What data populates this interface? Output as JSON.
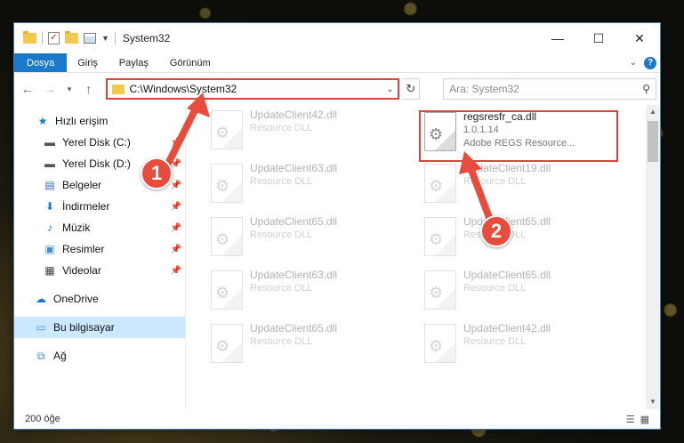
{
  "window": {
    "title": "System32",
    "controls": {
      "minimize": "—",
      "maximize": "☐",
      "close": "✕"
    }
  },
  "ribbon": {
    "tabs": [
      "Dosya",
      "Giriş",
      "Paylaş",
      "Görünüm"
    ]
  },
  "address": {
    "path": "C:\\Windows\\System32",
    "search_placeholder": "Ara: System32"
  },
  "sidebar": {
    "quick_access": "Hızlı erişim",
    "items": [
      {
        "label": "Yerel Disk (C:)",
        "icon": "drive-icon",
        "pinned": true
      },
      {
        "label": "Yerel Disk (D:)",
        "icon": "drive-icon",
        "pinned": true
      },
      {
        "label": "Belgeler",
        "icon": "documents-icon",
        "pinned": true
      },
      {
        "label": "İndirmeler",
        "icon": "download-icon",
        "pinned": true
      },
      {
        "label": "Müzik",
        "icon": "music-icon",
        "pinned": true
      },
      {
        "label": "Resimler",
        "icon": "pictures-icon",
        "pinned": true
      },
      {
        "label": "Videolar",
        "icon": "videos-icon",
        "pinned": true
      }
    ],
    "onedrive": "OneDrive",
    "this_pc": "Bu bilgisayar",
    "network": "Ağ"
  },
  "files": {
    "left_column": [
      {
        "name": "UpdateClient42.dll",
        "type": "Resource DLL"
      },
      {
        "name": "UpdateClient63.dll",
        "type": "Resource DLL"
      },
      {
        "name": "UpdateClient65.dll",
        "type": "Resource DLL"
      },
      {
        "name": "UpdateClient63.dll",
        "type": "Resource DLL"
      },
      {
        "name": "UpdateClient65.dll",
        "type": "Resource DLL"
      }
    ],
    "right_column": [
      {
        "name": "regsresfr_ca.dll",
        "version": "1.0.1.14",
        "type": "Adobe REGS Resource..."
      },
      {
        "name": "UpdateClient19.dll",
        "type": "Resource DLL"
      },
      {
        "name": "UpdateClient65.dll",
        "type": "Resource DLL"
      },
      {
        "name": "UpdateClient65.dll",
        "type": "Resource DLL"
      },
      {
        "name": "UpdateClient42.dll",
        "type": "Resource DLL"
      }
    ]
  },
  "status": {
    "count": "200 öğe"
  },
  "callouts": [
    "1",
    "2"
  ],
  "colors": {
    "accent": "#1979ca",
    "highlight": "#d9443c",
    "callout": "#e74c3c",
    "selected": "#cce8ff"
  }
}
